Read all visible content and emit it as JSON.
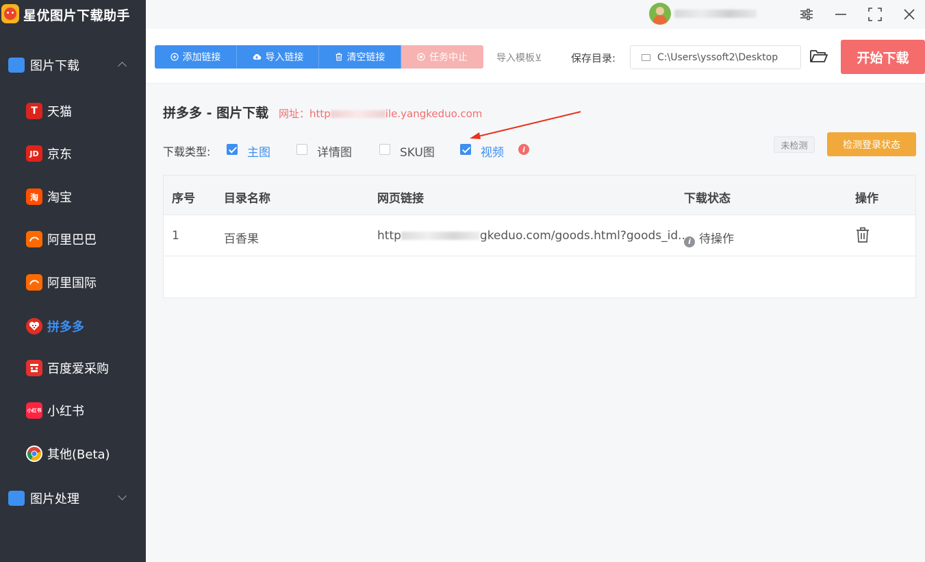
{
  "app": {
    "name": "星优图片下载助手"
  },
  "sidebar": {
    "groups": [
      {
        "label": "图片下载",
        "expanded": true
      },
      {
        "label": "图片处理",
        "expanded": false
      }
    ],
    "items": [
      {
        "label": "天猫",
        "icon": "tmall-icon",
        "icon_text": "T",
        "color": "#d9251c"
      },
      {
        "label": "京东",
        "icon": "jd-icon",
        "icon_text": "JD",
        "color": "#e2231a"
      },
      {
        "label": "淘宝",
        "icon": "taobao-icon",
        "icon_text": "淘",
        "color": "#ff5000"
      },
      {
        "label": "阿里巴巴",
        "icon": "alibaba-icon",
        "icon_text": "",
        "color": "#ff6a00"
      },
      {
        "label": "阿里国际",
        "icon": "alibaba-intl-icon",
        "icon_text": "",
        "color": "#ff6a00"
      },
      {
        "label": "拼多多",
        "icon": "pinduoduo-icon",
        "icon_text": "",
        "color": "#e02e24",
        "active": true
      },
      {
        "label": "百度爱采购",
        "icon": "baidu-aicaigou-icon",
        "icon_text": "",
        "color": "#e5312b"
      },
      {
        "label": "小红书",
        "icon": "xiaohongshu-icon",
        "icon_text": "小红书",
        "color": "#ff2442"
      },
      {
        "label": "其他(Beta)",
        "icon": "chrome-icon",
        "icon_text": "",
        "color": "#ffffff"
      }
    ]
  },
  "titlebar": {
    "username": "45l3ulc"
  },
  "toolbar": {
    "add_link": "添加链接",
    "import_link": "导入链接",
    "clear_link": "清空链接",
    "stop_task": "任务中止",
    "import_template": "导入模板⊻",
    "save_dir_label": "保存目录:",
    "save_dir_value": "C:\\Users\\yssoft2\\Desktop",
    "start_download": "开始下载"
  },
  "main": {
    "title": "拼多多 - 图片下载",
    "site_prefix": "网址：http",
    "site_suffix": "ile.yangkeduo.com",
    "download_type_label": "下载类型:",
    "types": [
      {
        "label": "主图",
        "checked": true
      },
      {
        "label": "详情图",
        "checked": false
      },
      {
        "label": "SKU图",
        "checked": false
      },
      {
        "label": "视频",
        "checked": true
      }
    ],
    "login_status": "未检测",
    "check_login": "检测登录状态"
  },
  "table": {
    "headers": [
      "序号",
      "目录名称",
      "网页链接",
      "下载状态",
      "操作"
    ],
    "rows": [
      {
        "index": "1",
        "name": "百香果",
        "link_prefix": "http",
        "link_suffix": "gkeduo.com/goods.html?goods_id...",
        "status": "待操作"
      }
    ]
  }
}
